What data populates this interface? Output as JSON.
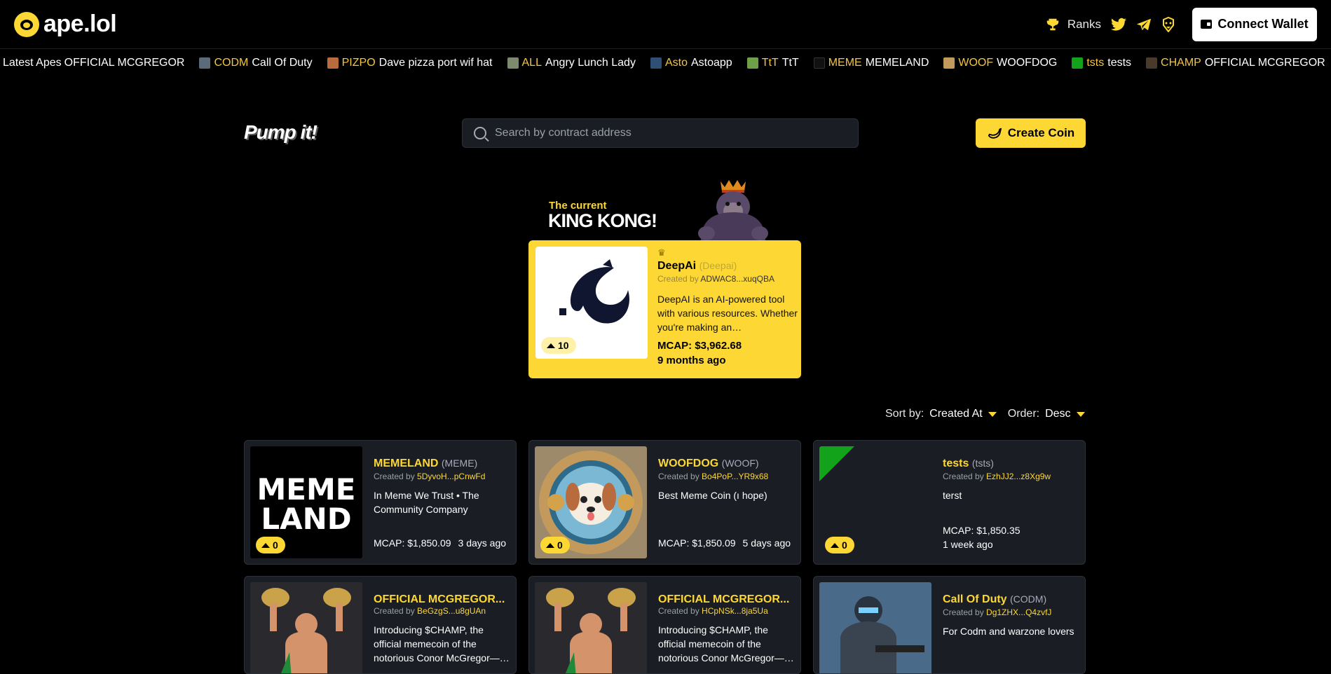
{
  "header": {
    "logo_text": "ape.lol",
    "ranks_label": "Ranks",
    "connect_label": "Connect Wallet"
  },
  "ticker": {
    "label": "Latest Apes",
    "items": [
      {
        "symbol": "",
        "name": "OFFICIAL MCGREGOR",
        "thumb": "#000000"
      },
      {
        "symbol": "CODM",
        "name": "Call Of Duty",
        "thumb": "#5a6b7a"
      },
      {
        "symbol": "PIZPO",
        "name": "Dave pizza port wif hat",
        "thumb": "#b86b3c"
      },
      {
        "symbol": "ALL",
        "name": "Angry Lunch Lady",
        "thumb": "#7d8a6e"
      },
      {
        "symbol": "Asto",
        "name": "Astoapp",
        "thumb": "#2f4f75"
      },
      {
        "symbol": "TtT",
        "name": "TtT",
        "thumb": "#6ea04a"
      },
      {
        "symbol": "MEME",
        "name": "MEMELAND",
        "thumb": "#111111"
      },
      {
        "symbol": "WOOF",
        "name": "WOOFDOG",
        "thumb": "#c49a5c"
      },
      {
        "symbol": "tsts",
        "name": "tests",
        "thumb": "#12a31a"
      },
      {
        "symbol": "CHAMP",
        "name": "OFFICIAL MCGREGOR",
        "thumb": "#4a3a2a"
      }
    ]
  },
  "pump_title": "Pump it!",
  "search": {
    "placeholder": "Search by contract address"
  },
  "create_label": "Create Coin",
  "king": {
    "subtitle": "The current",
    "title": "KING KONG!",
    "name": "DeepAi",
    "symbol": "(Deepai)",
    "created_prefix": "Created by",
    "creator": "ADWAC8...xuqQBA",
    "description": "DeepAI is an AI-powered tool with various resources. Whether you're making an…",
    "mcap": "MCAP: $3,962.68",
    "time": "9 months ago",
    "votes": "10"
  },
  "sort": {
    "sort_label": "Sort by:",
    "sort_value": "Created At",
    "order_label": "Order:",
    "order_value": "Desc"
  },
  "cards": [
    {
      "name": "MEMELAND",
      "symbol": "(MEME)",
      "created_prefix": "Created by",
      "creator": "5DyvoH...pCnwFd",
      "description": "In Meme We Trust • The Community Company",
      "mcap": "MCAP: $1,850.09",
      "time": "3 days ago",
      "votes": "0"
    },
    {
      "name": "WOOFDOG",
      "symbol": "(WOOF)",
      "created_prefix": "Created by",
      "creator": "Bo4PoP...YR9x68",
      "description": "Best Meme Coin (ı hope)",
      "mcap": "MCAP: $1,850.09",
      "time": "5 days ago",
      "votes": "0"
    },
    {
      "name": "tests",
      "symbol": "(tsts)",
      "created_prefix": "Created by",
      "creator": "EzhJJ2...z8Xg9w",
      "description": "terst",
      "mcap": "MCAP: $1,850.35",
      "time": "1 week ago",
      "votes": "0"
    },
    {
      "name": "OFFICIAL MCGREGOR...",
      "symbol": "",
      "created_prefix": "Created by",
      "creator": "BeGzgS...u8gUAn",
      "description": "Introducing $CHAMP, the official memecoin of the notorious Conor McGregor—…",
      "mcap": "",
      "time": "",
      "votes": ""
    },
    {
      "name": "OFFICIAL MCGREGOR...",
      "symbol": "",
      "created_prefix": "Created by",
      "creator": "HCpNSk...8ja5Ua",
      "description": "Introducing $CHAMP, the official memecoin of the notorious Conor McGregor—…",
      "mcap": "",
      "time": "",
      "votes": ""
    },
    {
      "name": "Call Of Duty",
      "symbol": "(CODM)",
      "created_prefix": "Created by",
      "creator": "Dg1ZHX...Q4zvfJ",
      "description": "For Codm and warzone lovers",
      "mcap": "",
      "time": "",
      "votes": ""
    }
  ],
  "colors": {
    "accent": "#fdd835",
    "card_bg": "#1a1d24",
    "page_bg": "#000000"
  },
  "icons": [
    "ape-logo-icon",
    "trophy-icon",
    "twitter-icon",
    "telegram-icon",
    "lion-icon",
    "wallet-icon",
    "search-icon",
    "banana-icon",
    "crown-icon",
    "upvote-icon"
  ]
}
